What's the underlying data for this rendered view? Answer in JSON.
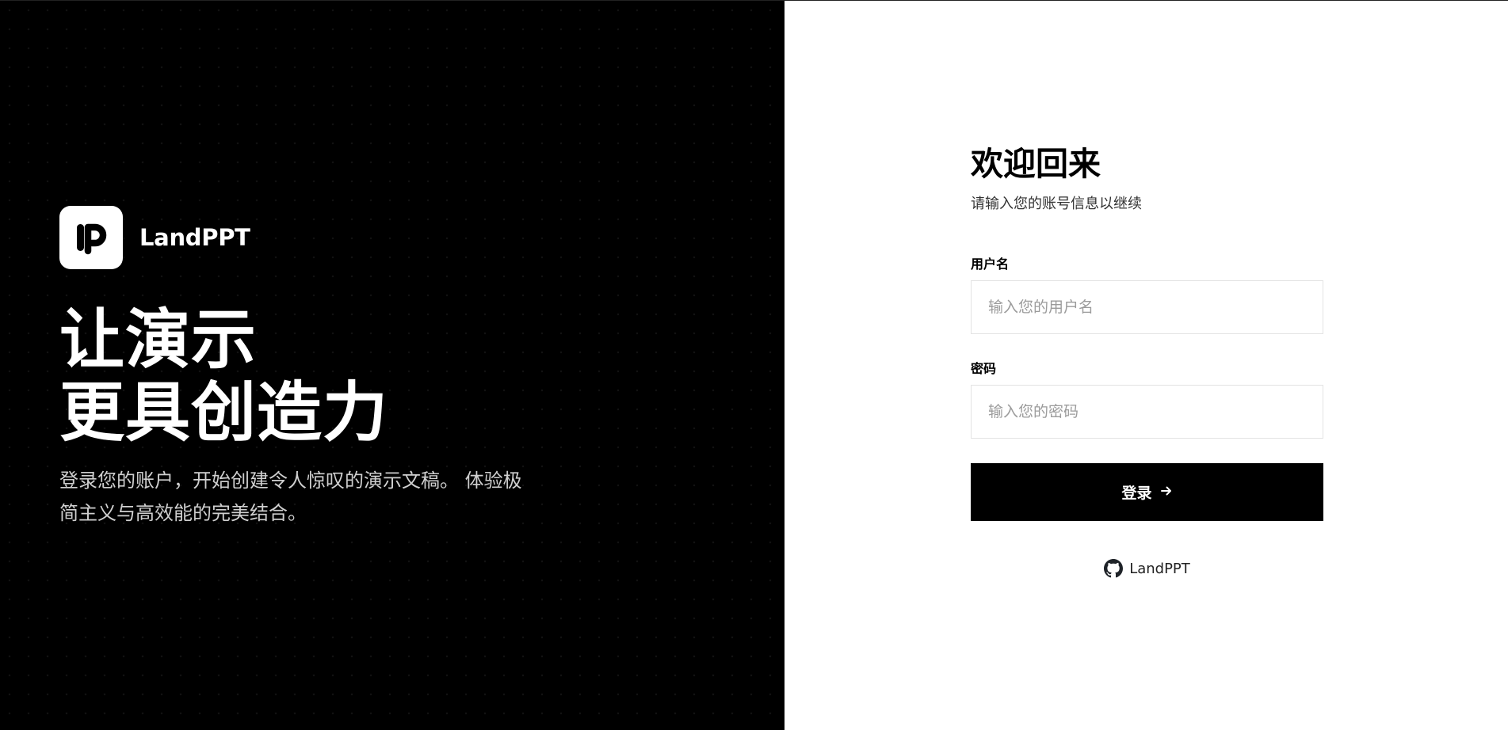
{
  "brand": {
    "logo_text": "LP",
    "name": "LandPPT"
  },
  "hero": {
    "headline_line1": "让演示",
    "headline_line2": "更具创造力",
    "description": "登录您的账户，开始创建令人惊叹的演示文稿。 体验极简主义与高效能的完美结合。"
  },
  "login": {
    "title": "欢迎回来",
    "subtitle": "请输入您的账号信息以继续",
    "username_label": "用户名",
    "username_placeholder": "输入您的用户名",
    "username_value": "",
    "password_label": "密码",
    "password_placeholder": "输入您的密码",
    "password_value": "",
    "submit_label": "登录",
    "submit_icon": "arrow-right-icon",
    "github_icon": "github-icon",
    "github_label": "LandPPT"
  },
  "colors": {
    "left_background": "#000000",
    "right_background": "#ffffff",
    "button_background": "#000000",
    "input_border": "#e3e3e3"
  }
}
